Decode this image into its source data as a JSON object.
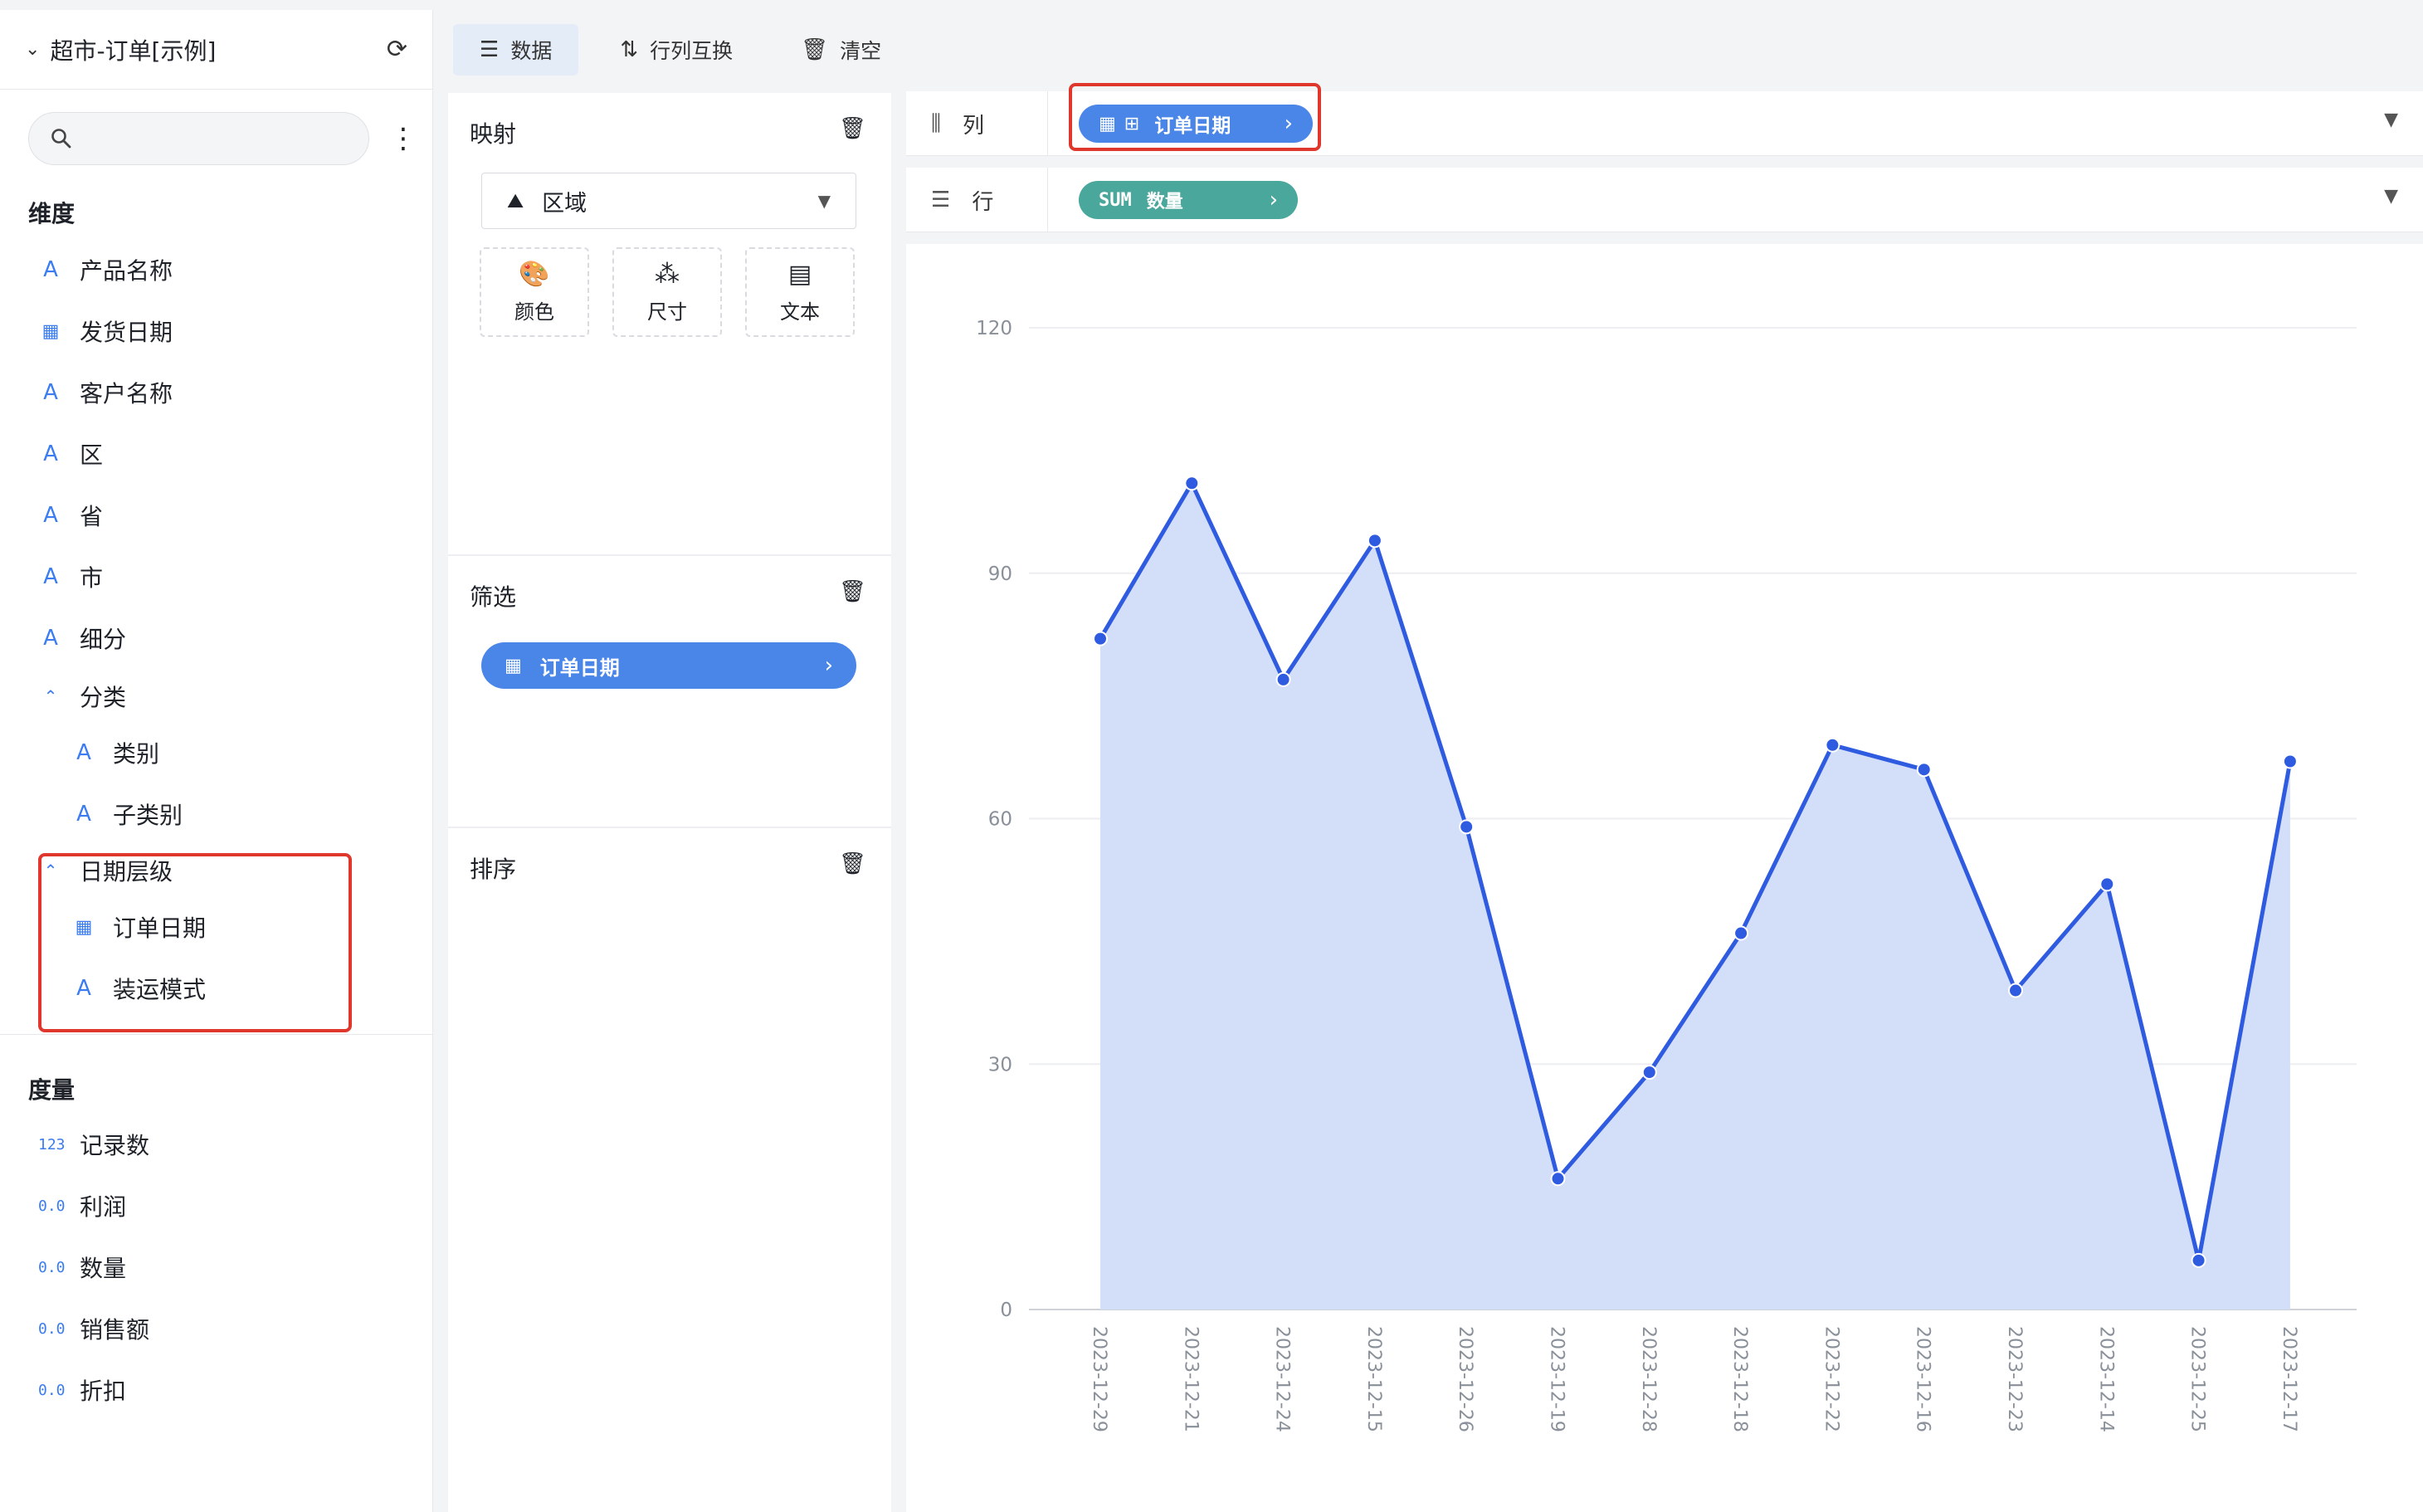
{
  "dataset": {
    "title": "超市-订单[示例]"
  },
  "search": {
    "placeholder": ""
  },
  "dimensions": {
    "title": "维度",
    "items": [
      {
        "label": "产品名称",
        "icon": "A"
      },
      {
        "label": "发货日期",
        "icon": "calendar"
      },
      {
        "label": "客户名称",
        "icon": "A"
      },
      {
        "label": "区",
        "icon": "A"
      },
      {
        "label": "省",
        "icon": "A"
      },
      {
        "label": "市",
        "icon": "A"
      },
      {
        "label": "细分",
        "icon": "A"
      }
    ],
    "group_category": {
      "label": "分类",
      "children": [
        "类别",
        "子类别"
      ]
    },
    "group_date": {
      "label": "日期层级",
      "children": [
        "订单日期",
        "装运模式"
      ]
    }
  },
  "measures": {
    "title": "度量",
    "items": [
      {
        "label": "记录数",
        "icon": "123"
      },
      {
        "label": "利润",
        "icon": "0.0"
      },
      {
        "label": "数量",
        "icon": "0.0"
      },
      {
        "label": "销售额",
        "icon": "0.0"
      },
      {
        "label": "折扣",
        "icon": "0.0"
      }
    ]
  },
  "toolbar": {
    "data": "数据",
    "swap": "行列互换",
    "clear": "清空"
  },
  "mapping": {
    "title": "映射",
    "chart_type": "区域",
    "marks": {
      "color": "颜色",
      "size": "尺寸",
      "text": "文本"
    }
  },
  "filter": {
    "title": "筛选",
    "pill": "订单日期"
  },
  "sort": {
    "title": "排序"
  },
  "shelves": {
    "columns": {
      "label": "列",
      "pill": "订单日期"
    },
    "rows": {
      "label": "行",
      "agg": "SUM",
      "pill": "数量"
    }
  },
  "colors": {
    "line": "#2f5be0",
    "area": "#d3def8",
    "pill_blue": "#4a86e8",
    "pill_green": "#4aa79b",
    "highlight": "#e0372c"
  },
  "chart_data": {
    "type": "area",
    "categories": [
      "2023-12-29",
      "2023-12-21",
      "2023-12-24",
      "2023-12-15",
      "2023-12-26",
      "2023-12-19",
      "2023-12-28",
      "2023-12-18",
      "2023-12-22",
      "2023-12-16",
      "2023-12-23",
      "2023-12-14",
      "2023-12-25",
      "2023-12-17"
    ],
    "values": [
      82,
      101,
      77,
      94,
      59,
      16,
      29,
      46,
      69,
      66,
      39,
      52,
      6,
      67
    ],
    "yticks": [
      0,
      30,
      60,
      90,
      120
    ],
    "ylim": [
      0,
      120
    ],
    "grid": true
  }
}
